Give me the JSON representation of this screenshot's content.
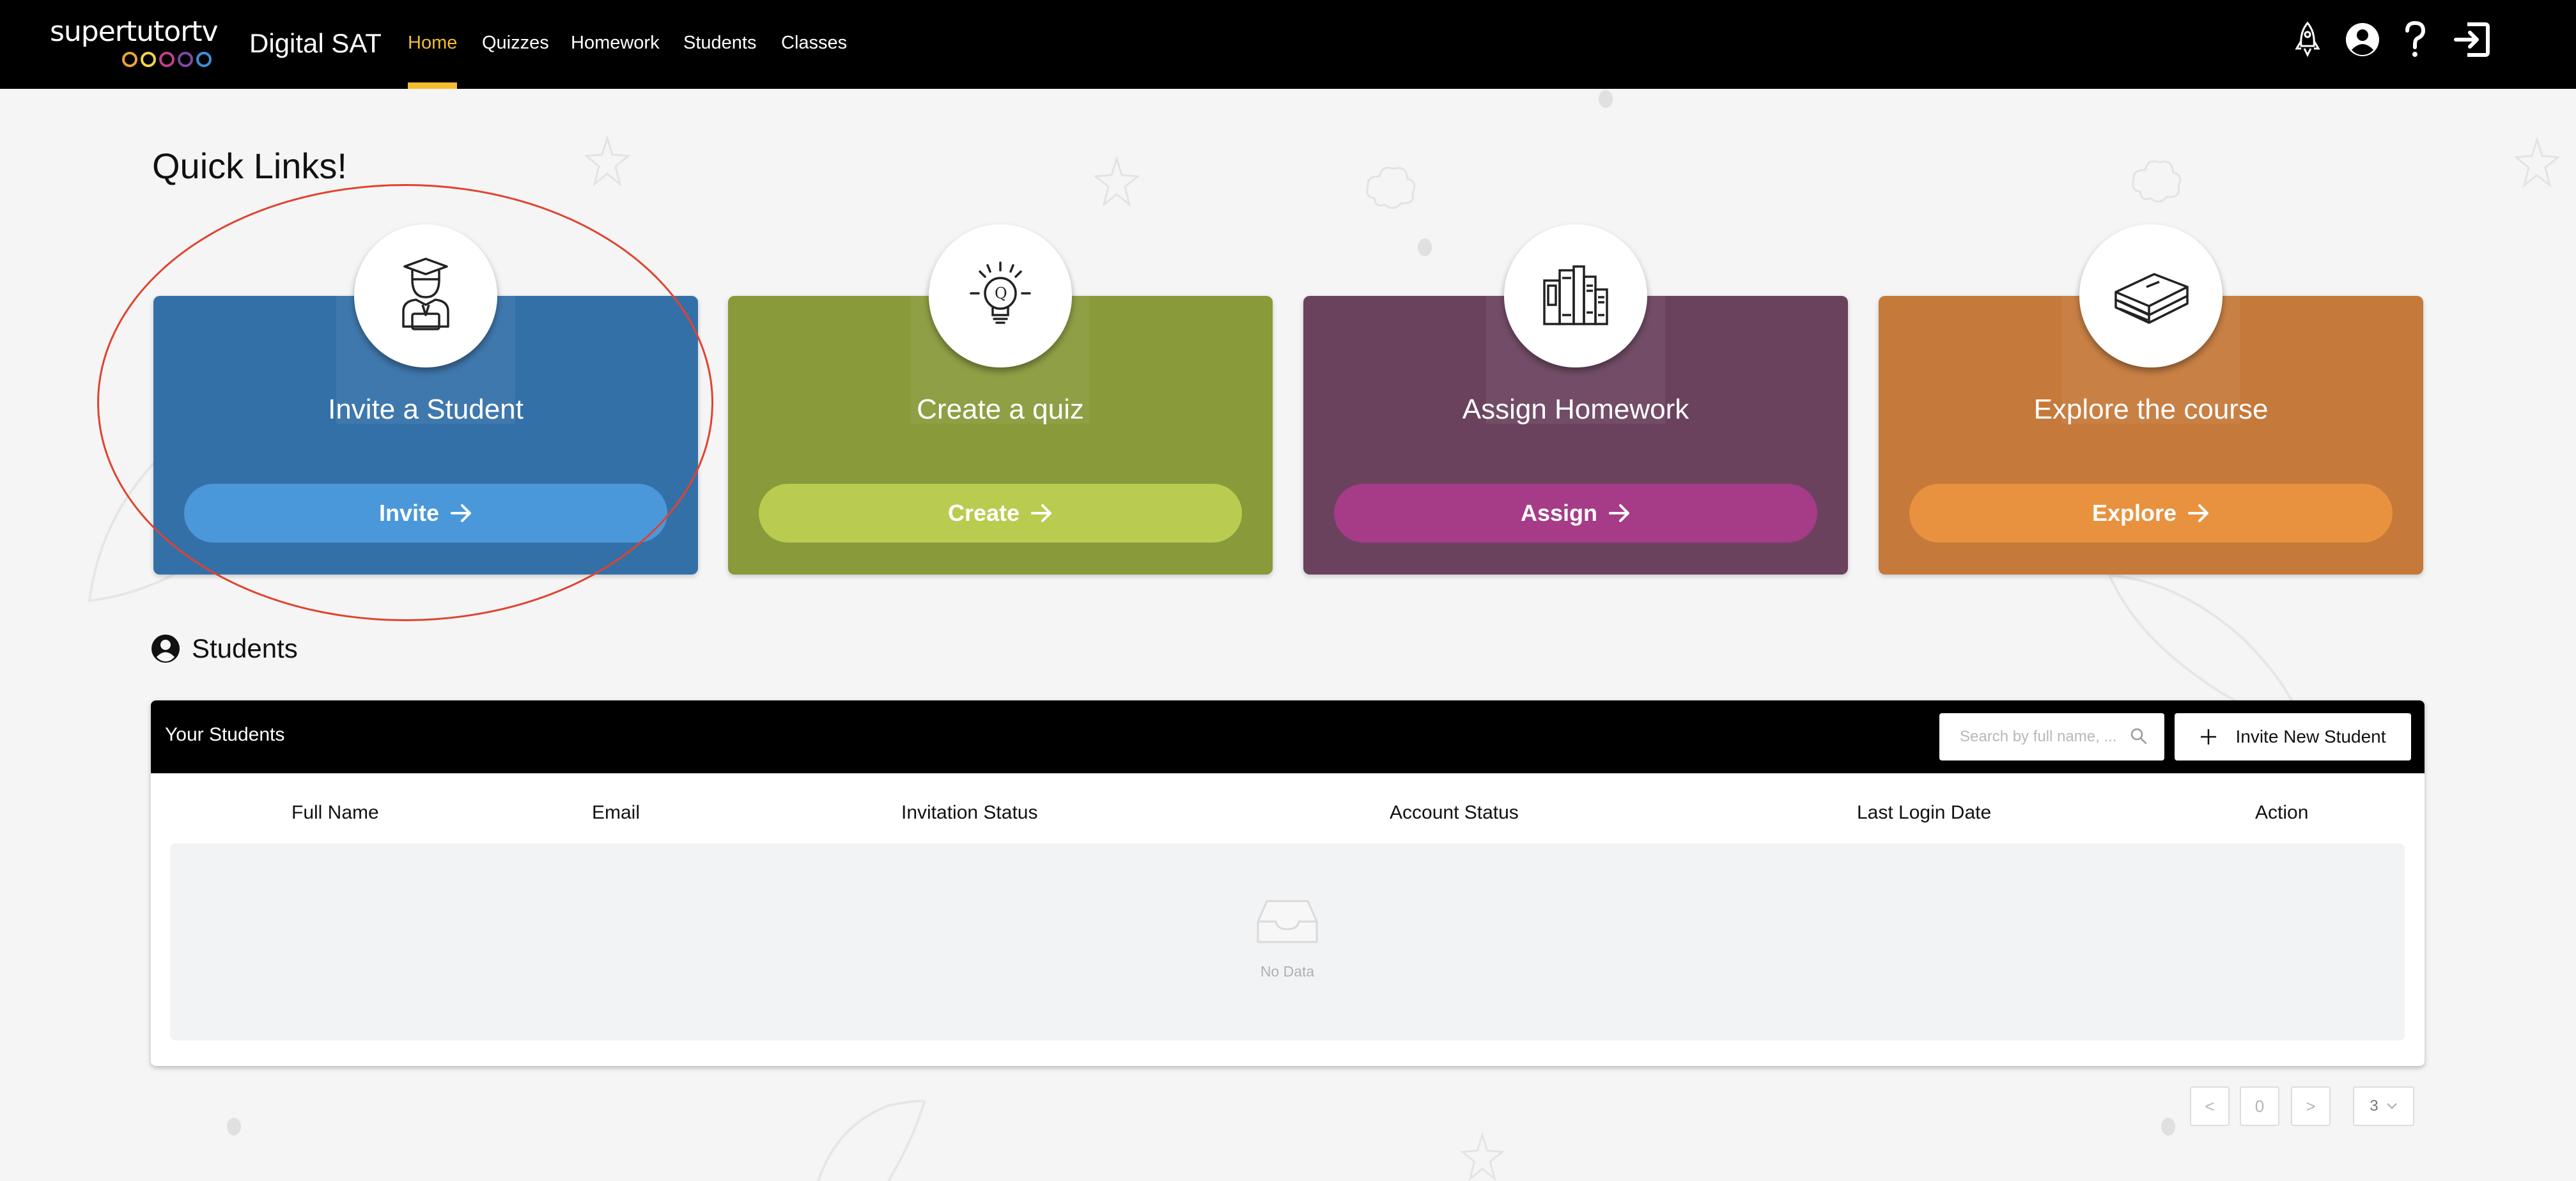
{
  "nav": {
    "logo_text": "supertutortv",
    "logo_ring_colors": [
      "#e8a33d",
      "#f2d14b",
      "#c23f8b",
      "#7d4aa1",
      "#3d8fd6"
    ],
    "app_name": "Digital SAT",
    "links": [
      {
        "label": "Home",
        "active": true
      },
      {
        "label": "Quizzes",
        "active": false
      },
      {
        "label": "Homework",
        "active": false
      },
      {
        "label": "Students",
        "active": false
      },
      {
        "label": "Classes",
        "active": false
      }
    ],
    "right_icons": [
      "rocket-icon",
      "user-account-icon",
      "help-icon",
      "logout-icon"
    ],
    "accent_color": "#f2bd2e"
  },
  "quick_links": {
    "heading": "Quick Links!",
    "cards": [
      {
        "title": "Invite a Student",
        "button": "Invite",
        "icon": "graduate-student-icon",
        "card_color": "#3470a8",
        "button_color": "#4a98d9"
      },
      {
        "title": "Create a quiz",
        "button": "Create",
        "icon": "lightbulb-quiz-icon",
        "card_color": "#889a3a",
        "button_color": "#b9cc50"
      },
      {
        "title": "Assign Homework",
        "button": "Assign",
        "icon": "books-icon",
        "card_color": "#6b425e",
        "button_color": "#a63b87"
      },
      {
        "title": "Explore the course",
        "button": "Explore",
        "icon": "book-stack-icon",
        "card_color": "#c5793a",
        "button_color": "#e8923f"
      }
    ]
  },
  "students": {
    "section_title": "Students",
    "table_title": "Your Students",
    "search_placeholder": "Search by full name, ...",
    "invite_button": "Invite New Student",
    "columns": [
      "Full Name",
      "Email",
      "Invitation Status",
      "Account Status",
      "Last Login Date",
      "Action"
    ],
    "rows": [],
    "empty_text": "No Data"
  },
  "pagination": {
    "prev": "<",
    "current_page": "0",
    "next": ">",
    "page_size": "3"
  }
}
